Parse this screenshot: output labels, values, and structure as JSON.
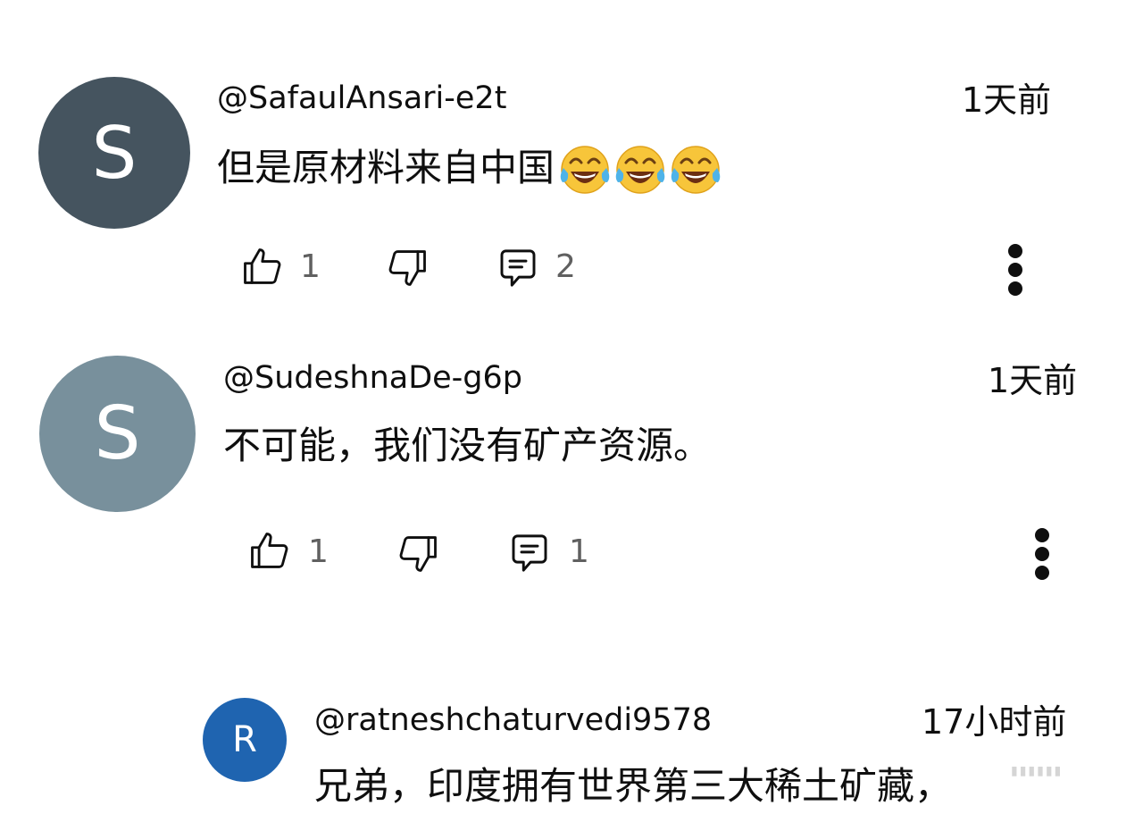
{
  "comments": [
    {
      "avatar_letter": "S",
      "avatar_color": "#45545f",
      "author": "@SafaulAnsari-e2t",
      "time": "1天前",
      "text": "但是原材料来自中国",
      "emoji": "face-with-tears-of-joy",
      "emoji_count": 3,
      "likes": "1",
      "replies": "2"
    },
    {
      "avatar_letter": "S",
      "avatar_color": "#78909c",
      "author": "@SudeshnaDe-g6p",
      "time": "1天前",
      "text": "不可能，我们没有矿产资源。",
      "likes": "1",
      "replies": "1"
    },
    {
      "avatar_letter": "R",
      "avatar_color": "#1f64b0",
      "author": "@ratneshchaturvedi9578",
      "time": "17小时前",
      "text": "兄弟，印度拥有世界第三大稀土矿藏，"
    }
  ],
  "icons": {
    "like": "thumbs-up-icon",
    "dislike": "thumbs-down-icon",
    "reply": "comment-icon",
    "more": "more-vert-icon"
  },
  "colors": {
    "text": "#0f0f0f",
    "secondary_text": "#606060",
    "icon": "#0f0f0f"
  }
}
